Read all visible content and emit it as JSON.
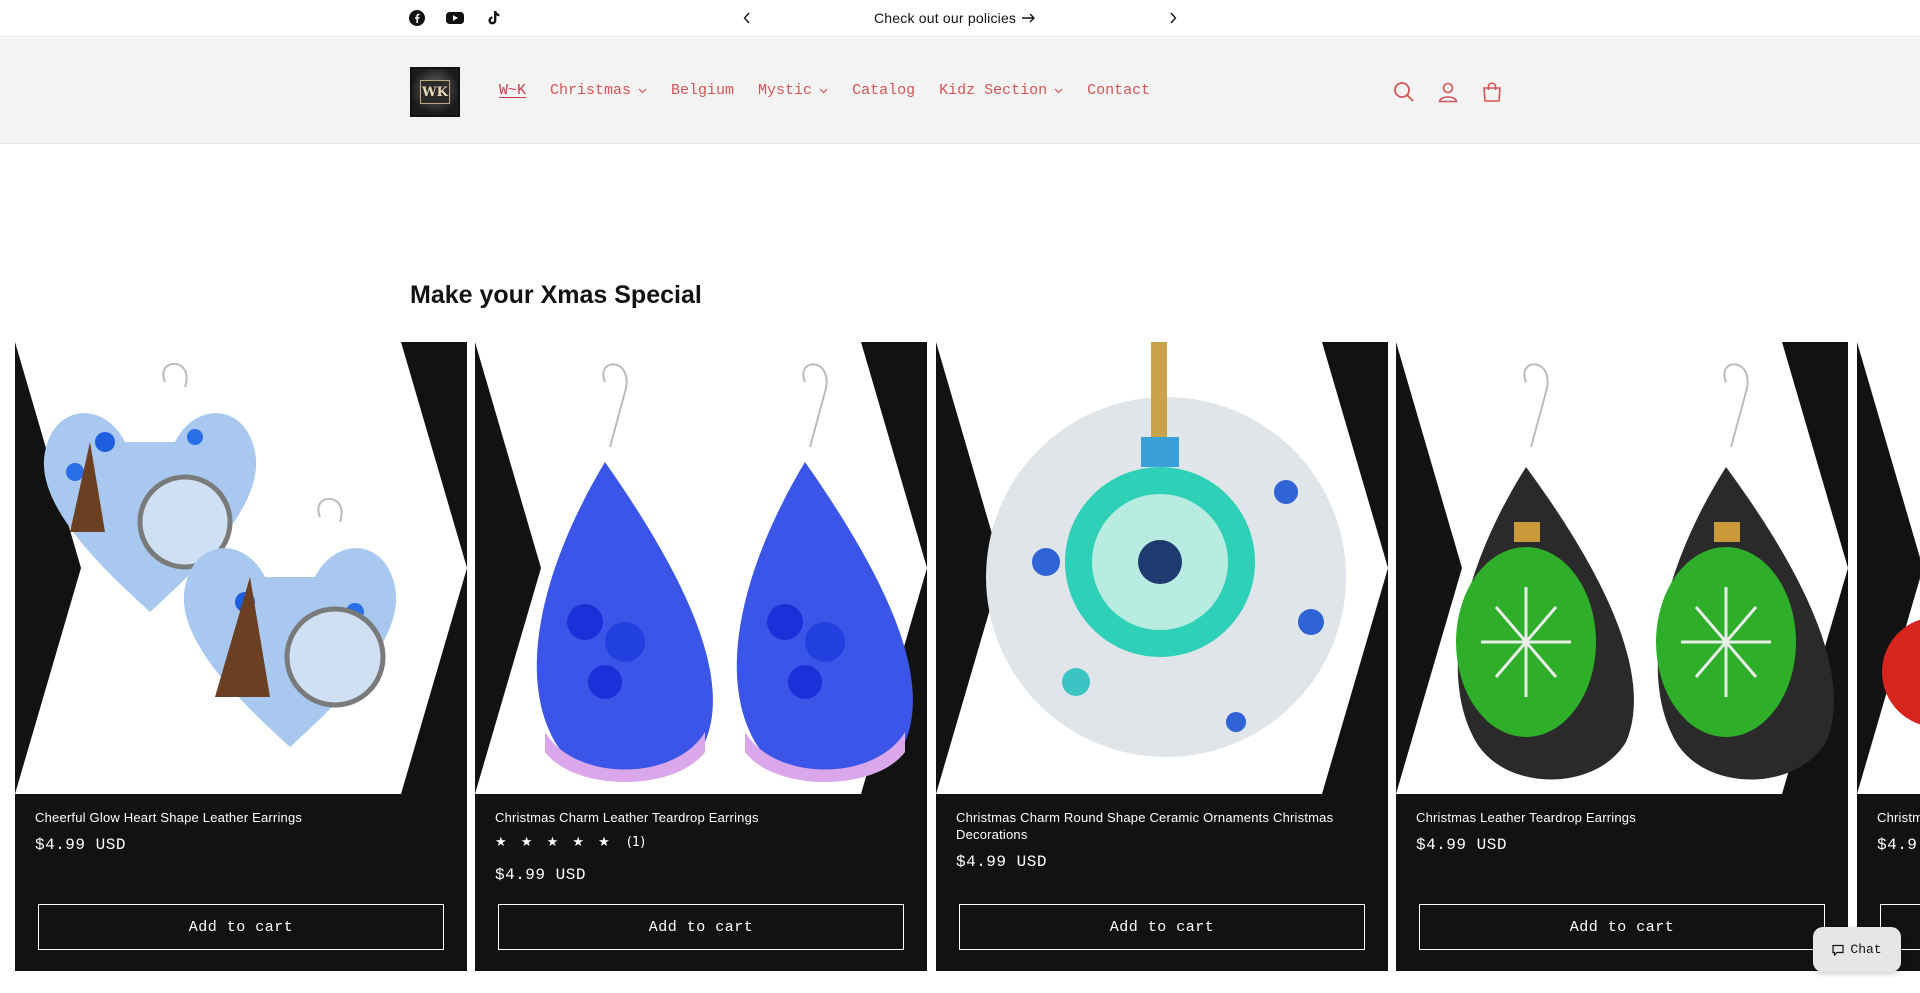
{
  "announcement": {
    "text": "Check out our policies",
    "social": [
      "facebook-icon",
      "youtube-icon",
      "tiktok-icon"
    ]
  },
  "header": {
    "logo_text": "WK",
    "nav": [
      {
        "label": "W~K",
        "active": true,
        "dropdown": false
      },
      {
        "label": "Christmas",
        "active": false,
        "dropdown": true
      },
      {
        "label": "Belgium",
        "active": false,
        "dropdown": false
      },
      {
        "label": "Mystic",
        "active": false,
        "dropdown": true
      },
      {
        "label": "Catalog",
        "active": false,
        "dropdown": false
      },
      {
        "label": "Kidz Section",
        "active": false,
        "dropdown": true
      },
      {
        "label": "Contact",
        "active": false,
        "dropdown": false
      }
    ],
    "icons": [
      "search-icon",
      "account-icon",
      "cart-icon"
    ]
  },
  "section": {
    "title": "Make your Xmas Special"
  },
  "products": [
    {
      "title": "Cheerful Glow Heart Shape Leather Earrings",
      "price": "$4.99 USD",
      "button": "Add to cart"
    },
    {
      "title": "Christmas Charm Leather Teardrop Earrings",
      "stars": "★ ★ ★ ★ ★",
      "rating_count": "(1)",
      "rating": 5,
      "price": "$4.99 USD",
      "button": "Add to cart"
    },
    {
      "title": "Christmas Charm Round Shape Ceramic Ornaments Christmas Decorations",
      "price": "$4.99 USD",
      "button": "Add to cart"
    },
    {
      "title": "Christmas Leather Teardrop Earrings",
      "price": "$4.99 USD",
      "button": "Add to cart"
    },
    {
      "title": "Christm",
      "price": "$4.9",
      "button": ""
    }
  ],
  "chat": {
    "label": "Chat"
  },
  "colors": {
    "accent": "#d45555",
    "card_bg": "#121212",
    "header_bg": "#f3f3f3"
  }
}
